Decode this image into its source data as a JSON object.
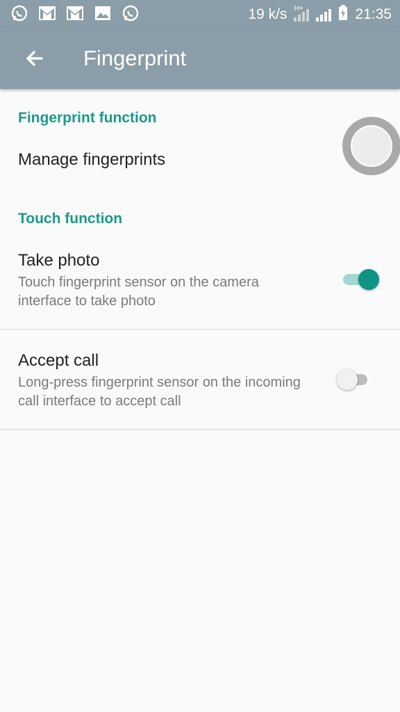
{
  "status_bar": {
    "notification_icons": [
      "whatsapp-icon",
      "gmail-icon",
      "gmail-icon",
      "image-icon",
      "whatsapp-icon"
    ],
    "net_speed": "19 k/s",
    "network_type": "H+",
    "time": "21:35"
  },
  "app_bar": {
    "title": "Fingerprint"
  },
  "sections": {
    "fingerprint_function": {
      "header": "Fingerprint function",
      "manage": {
        "title": "Manage fingerprints"
      }
    },
    "touch_function": {
      "header": "Touch function",
      "take_photo": {
        "title": "Take photo",
        "subtitle": "Touch fingerprint sensor on the camera interface to take photo",
        "enabled": true
      },
      "accept_call": {
        "title": "Accept call",
        "subtitle": "Long-press fingerprint sensor on the incoming call interface to accept call",
        "enabled": false
      }
    }
  },
  "colors": {
    "app_bar": "#8a9da8",
    "accent": "#1a9a8a",
    "toggle_on": "#0f9483"
  }
}
